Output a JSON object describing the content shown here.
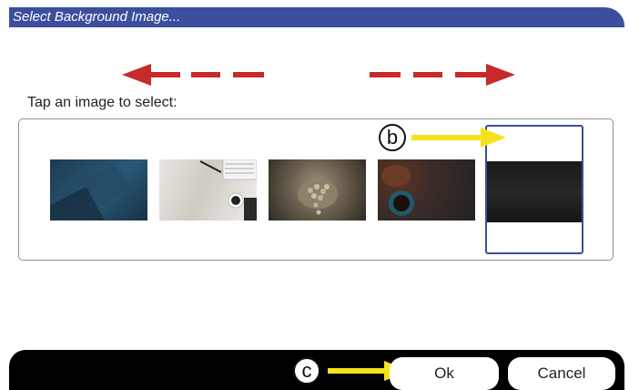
{
  "dialog": {
    "title": "Select Background Image...",
    "prompt": "Tap an image to select:",
    "accent_color": "#3b4f9e"
  },
  "gallery": {
    "nav_left_icon": "arrow-left-icon",
    "nav_right_icon": "arrow-right-icon",
    "images": [
      {
        "name": "dark-blue-paper"
      },
      {
        "name": "desk-with-coffee-and-keyboard"
      },
      {
        "name": "hands-holding-coffee-beans"
      },
      {
        "name": "coffee-cup-with-beans"
      },
      {
        "name": "dark-texture",
        "selected": true
      }
    ]
  },
  "annotations": {
    "b": "b",
    "c": "c",
    "arrow_color": "#f5e21b",
    "nav_arrow_color": "#c62a2a"
  },
  "buttons": {
    "ok": "Ok",
    "cancel": "Cancel"
  }
}
